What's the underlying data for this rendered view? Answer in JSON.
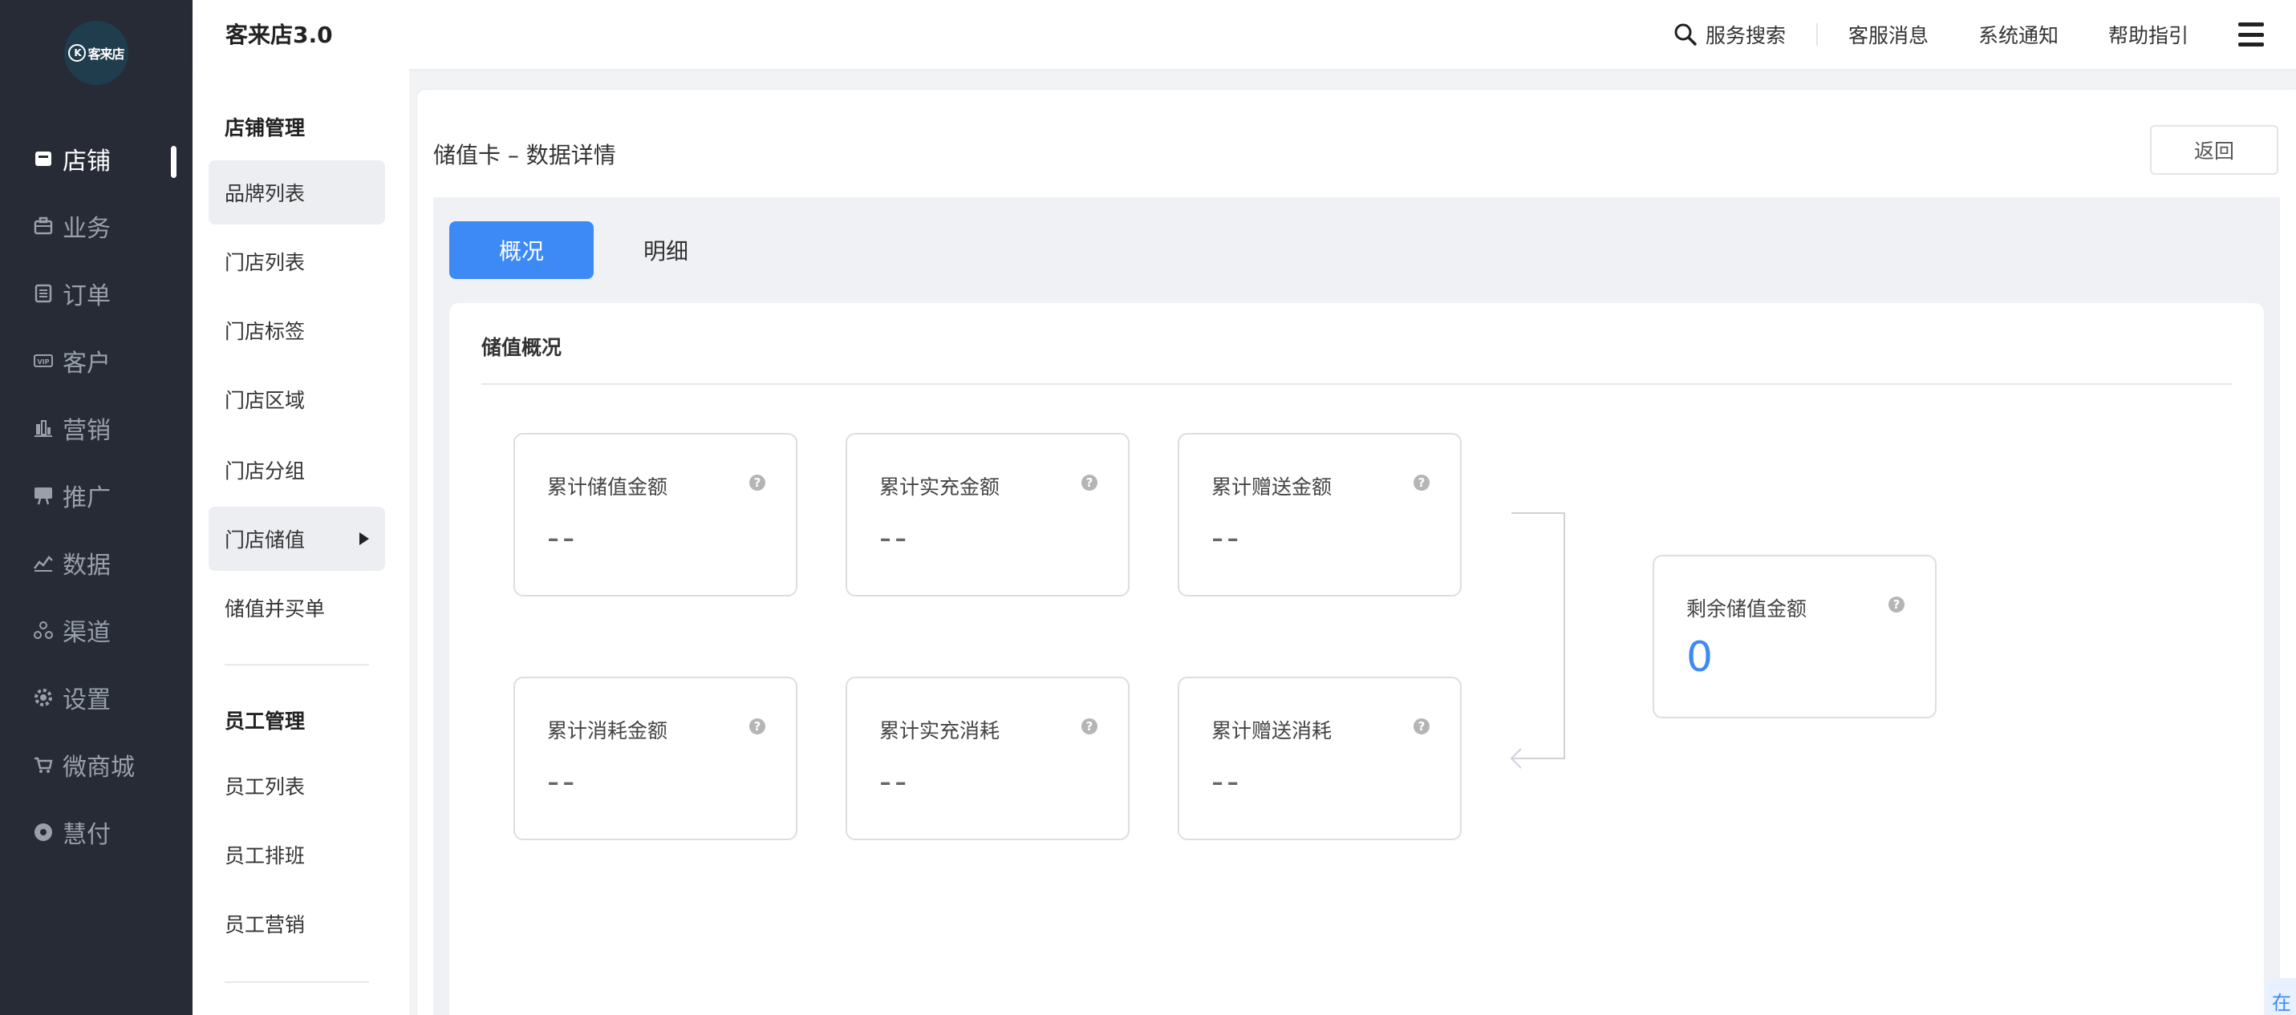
{
  "logo": {
    "text": "客来店"
  },
  "left_nav": [
    {
      "label": "店铺",
      "icon": "store-icon",
      "active": true
    },
    {
      "label": "业务",
      "icon": "briefcase-icon",
      "active": false
    },
    {
      "label": "订单",
      "icon": "order-icon",
      "active": false
    },
    {
      "label": "客户",
      "icon": "vip-icon",
      "active": false
    },
    {
      "label": "营销",
      "icon": "bar-chart-icon",
      "active": false
    },
    {
      "label": "推广",
      "icon": "billboard-icon",
      "active": false
    },
    {
      "label": "数据",
      "icon": "line-chart-icon",
      "active": false
    },
    {
      "label": "渠道",
      "icon": "channel-icon",
      "active": false
    },
    {
      "label": "设置",
      "icon": "gear-icon",
      "active": false
    },
    {
      "label": "微商城",
      "icon": "cart-icon",
      "active": false
    },
    {
      "label": "慧付",
      "icon": "pay-icon",
      "active": false
    }
  ],
  "header": {
    "title": "客来店3.0",
    "search_label": "服务搜索",
    "links": [
      "客服消息",
      "系统通知",
      "帮助指引"
    ]
  },
  "subnav": {
    "group1_title": "店铺管理",
    "group1_items": [
      "品牌列表",
      "门店列表",
      "门店标签",
      "门店区域",
      "门店分组",
      "门店储值",
      "储值并买单"
    ],
    "group2_title": "员工管理",
    "group2_items": [
      "员工列表",
      "员工排班",
      "员工营销"
    ]
  },
  "page": {
    "title": "储值卡 – 数据详情",
    "back_label": "返回",
    "tabs": [
      "概况",
      "明细"
    ],
    "section_title": "储值概况"
  },
  "stats": [
    {
      "label": "累计储值金额",
      "value": "--"
    },
    {
      "label": "累计实充金额",
      "value": "--"
    },
    {
      "label": "累计赠送金额",
      "value": "--"
    },
    {
      "label": "累计消耗金额",
      "value": "--"
    },
    {
      "label": "累计实充消耗",
      "value": "--"
    },
    {
      "label": "累计赠送消耗",
      "value": "--"
    }
  ],
  "remaining": {
    "label": "剩余储值金额",
    "value": "0"
  },
  "float_tab": {
    "text": "在"
  },
  "colors": {
    "accent": "#3d8af7",
    "nav_bg": "#262b36"
  }
}
